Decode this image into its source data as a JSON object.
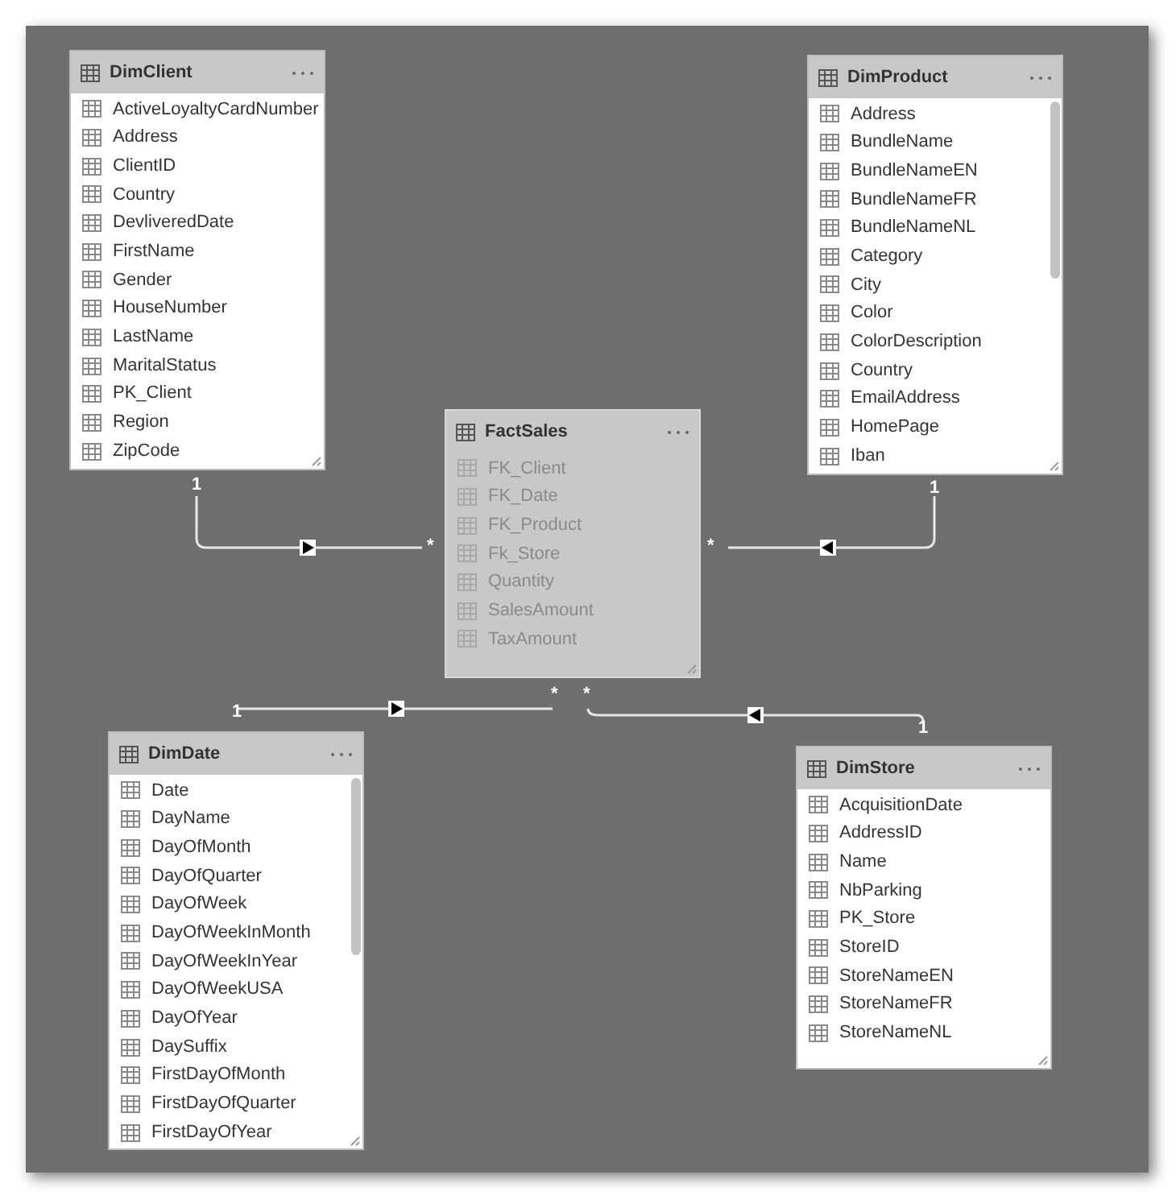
{
  "tables": [
    {
      "name": "DimClient",
      "selected": false,
      "scrollbar": false,
      "fields": [
        "ActiveLoyaltyCardNumber",
        "Address",
        "ClientID",
        "Country",
        "DevliveredDate",
        "FirstName",
        "Gender",
        "HouseNumber",
        "LastName",
        "MaritalStatus",
        "PK_Client",
        "Region",
        "ZipCode"
      ]
    },
    {
      "name": "DimProduct",
      "selected": false,
      "scrollbar": true,
      "fields": [
        "Address",
        "BundleName",
        "BundleNameEN",
        "BundleNameFR",
        "BundleNameNL",
        "Category",
        "City",
        "Color",
        "ColorDescription",
        "Country",
        "EmailAddress",
        "HomePage",
        "Iban"
      ]
    },
    {
      "name": "FactSales",
      "selected": true,
      "scrollbar": false,
      "fields": [
        "FK_Client",
        "FK_Date",
        "FK_Product",
        "Fk_Store",
        "Quantity",
        "SalesAmount",
        "TaxAmount"
      ]
    },
    {
      "name": "DimDate",
      "selected": false,
      "scrollbar": true,
      "fields": [
        "Date",
        "DayName",
        "DayOfMonth",
        "DayOfQuarter",
        "DayOfWeek",
        "DayOfWeekInMonth",
        "DayOfWeekInYear",
        "DayOfWeekUSA",
        "DayOfYear",
        "DaySuffix",
        "FirstDayOfMonth",
        "FirstDayOfQuarter",
        "FirstDayOfYear"
      ]
    },
    {
      "name": "DimStore",
      "selected": false,
      "scrollbar": false,
      "fields": [
        "AcquisitionDate",
        "AddressID",
        "Name",
        "NbParking",
        "PK_Store",
        "StoreID",
        "StoreNameEN",
        "StoreNameFR",
        "StoreNameNL"
      ]
    }
  ],
  "relationships": [
    {
      "one": "1",
      "many": "*"
    },
    {
      "one": "1",
      "many": "*"
    },
    {
      "one": "1",
      "many": "*"
    },
    {
      "one": "1",
      "many": "*"
    }
  ]
}
